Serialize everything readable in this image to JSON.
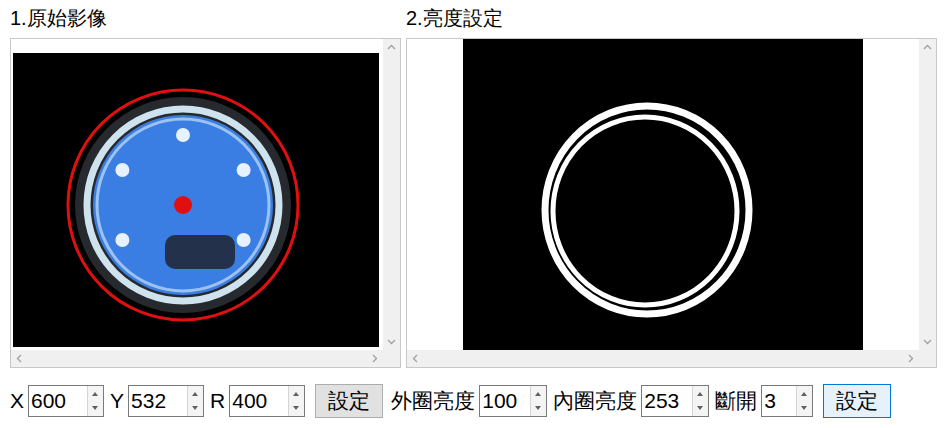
{
  "panels": [
    {
      "title": "1.原始影像",
      "kind": "source"
    },
    {
      "title": "2.亮度設定",
      "kind": "threshold"
    }
  ],
  "controls": [
    {
      "fields": [
        {
          "label": "X",
          "value": "600"
        },
        {
          "label": "Y",
          "value": "532"
        },
        {
          "label": "R",
          "value": "400"
        }
      ],
      "button": {
        "label": "設定",
        "focused": false
      }
    },
    {
      "fields": [
        {
          "label": "外圈亮度",
          "value": "100"
        },
        {
          "label": "內圈亮度",
          "value": "253"
        },
        {
          "label": "斷開",
          "value": "3"
        }
      ],
      "button": {
        "label": "設定",
        "focused": true
      }
    }
  ]
}
